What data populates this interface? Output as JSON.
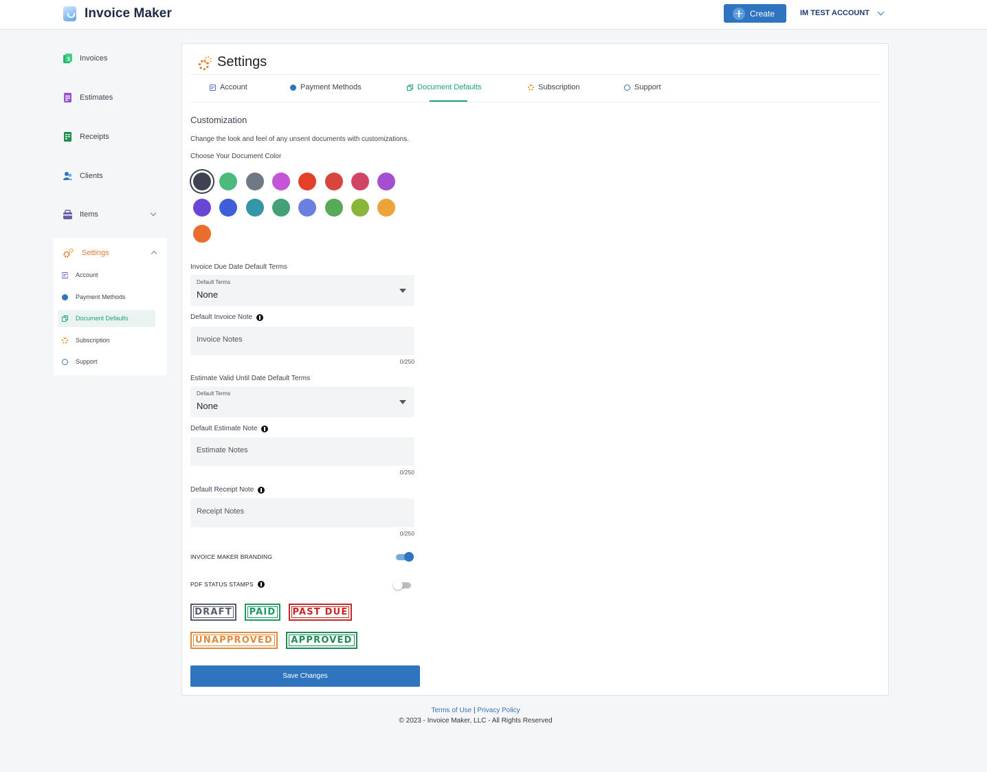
{
  "header": {
    "brand": "Invoice Maker",
    "create_label": "Create",
    "account_label": "IM TEST ACCOUNT"
  },
  "sidebar": {
    "items": [
      {
        "label": "Invoices",
        "icon": "invoice-icon",
        "color": "#27b36b"
      },
      {
        "label": "Estimates",
        "icon": "estimate-icon",
        "color": "#9b4fd1"
      },
      {
        "label": "Receipts",
        "icon": "receipt-icon",
        "color": "#1e8e4e"
      },
      {
        "label": "Clients",
        "icon": "clients-icon",
        "color": "#2f74bf"
      },
      {
        "label": "Items",
        "icon": "items-icon",
        "color": "#6b5ea8"
      },
      {
        "label": "Settings",
        "icon": "gear-icon",
        "color": "#e07a2e"
      }
    ],
    "settings_sub": [
      {
        "label": "Account",
        "icon": "account-icon",
        "color": "#5b6ad0"
      },
      {
        "label": "Payment Methods",
        "icon": "payment-icon",
        "color": "#2f74bf"
      },
      {
        "label": "Document Defaults",
        "icon": "document-icon",
        "color": "#19a37a"
      },
      {
        "label": "Subscription",
        "icon": "subscription-icon",
        "color": "#e8962e"
      },
      {
        "label": "Support",
        "icon": "support-icon",
        "color": "#2f74bf"
      }
    ]
  },
  "main": {
    "title": "Settings",
    "tabs": [
      {
        "label": "Account",
        "color": "#5b6ad0"
      },
      {
        "label": "Payment Methods",
        "color": "#2f74bf"
      },
      {
        "label": "Document Defaults",
        "color": "#19a37a"
      },
      {
        "label": "Subscription",
        "color": "#e8962e"
      },
      {
        "label": "Support",
        "color": "#2f74bf"
      }
    ],
    "active_tab": "Document Defaults",
    "section_title": "Customization",
    "description": "Change the look and feel of any unsent documents with customizations.",
    "color_label": "Choose Your Document Color",
    "colors": [
      "#3d4350",
      "#4cba7c",
      "#6f7885",
      "#c256d6",
      "#e3402a",
      "#d8453c",
      "#d14466",
      "#a54fd0",
      "#6a45d6",
      "#3e5fd9",
      "#3596a8",
      "#43a177",
      "#6a7fe0",
      "#58aa58",
      "#88b53a",
      "#eba33a",
      "#ea6d2f"
    ],
    "selected_color": "#3d4350",
    "invoice_due_label": "Invoice Due Date Default Terms",
    "invoice_terms": {
      "small": "Default Terms",
      "value": "None"
    },
    "invoice_note_label": "Default Invoice Note",
    "invoice_note_placeholder": "Invoice Notes",
    "invoice_note_counter": "0/250",
    "estimate_valid_label": "Estimate Valid Until Date Default Terms",
    "estimate_terms": {
      "small": "Default Terms",
      "value": "None"
    },
    "estimate_note_label": "Default Estimate Note",
    "estimate_note_placeholder": "Estimate Notes",
    "estimate_note_counter": "0/250",
    "receipt_note_label": "Default Receipt Note",
    "receipt_note_placeholder": "Receipt Notes",
    "receipt_note_counter": "0/250",
    "branding_label": "INVOICE MAKER BRANDING",
    "branding_on": true,
    "stamps_label": "PDF STATUS STAMPS",
    "stamps_on": false,
    "stamps": [
      {
        "label": "DRAFT",
        "color": "#555d6e"
      },
      {
        "label": "PAID",
        "color": "#1e9a5e"
      },
      {
        "label": "PAST DUE",
        "color": "#c62828"
      },
      {
        "label": "UNAPPROVED",
        "color": "#e08a3c"
      },
      {
        "label": "APPROVED",
        "color": "#1e8a54"
      }
    ],
    "save_label": "Save Changes"
  },
  "footer": {
    "terms": "Terms of Use",
    "separator": "|",
    "privacy": "Privacy Policy",
    "copyright": "© 2023 - Invoice Maker, LLC - All Rights Reserved"
  }
}
